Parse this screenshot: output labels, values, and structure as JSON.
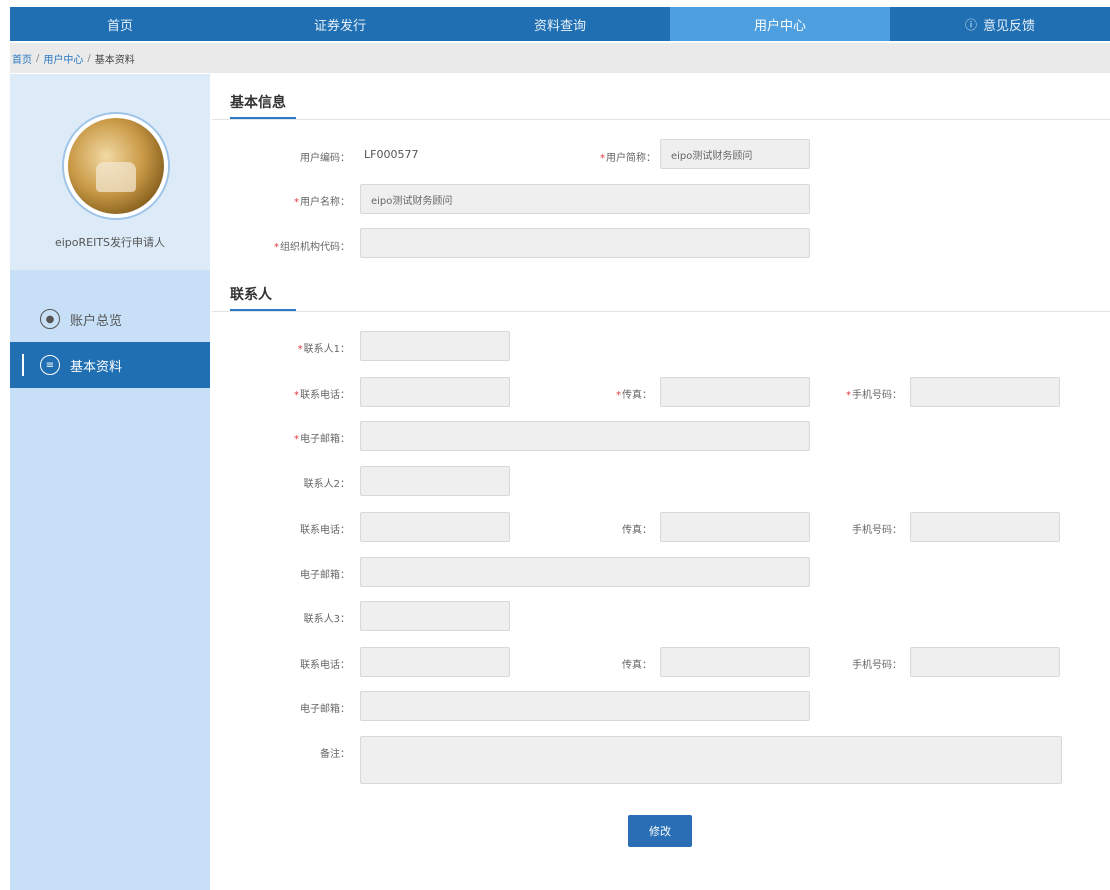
{
  "nav": {
    "items": [
      {
        "label": "首页"
      },
      {
        "label": "证券发行"
      },
      {
        "label": "资料查询"
      },
      {
        "label": "用户中心"
      },
      {
        "label": "意见反馈"
      }
    ]
  },
  "breadcrumb": {
    "home": "首页",
    "sep": "/",
    "user_center": "用户中心",
    "current": "基本资料"
  },
  "sidebar": {
    "profile_name": "eipoREITS发行申请人",
    "items": [
      {
        "label": "账户总览",
        "icon": "circle-dot-icon"
      },
      {
        "label": "基本资料",
        "icon": "list-circle-icon"
      }
    ]
  },
  "basic_info": {
    "title": "基本信息",
    "user_code_label": "用户编码：",
    "user_code_value": "LF000577",
    "nickname_label": "用户简称：",
    "nickname_value": "eipo测试财务顾问",
    "username_label": "用户名称：",
    "username_value": "eipo测试财务顾问",
    "org_code_label": "组织机构代码：",
    "org_code_value": ""
  },
  "contacts": {
    "title": "联系人",
    "c1": {
      "name_label": "联系人1：",
      "phone_label": "联系电话：",
      "fax_label": "传真：",
      "mobile_label": "手机号码：",
      "email_label": "电子邮箱："
    },
    "c2": {
      "name_label": "联系人2：",
      "phone_label": "联系电话：",
      "fax_label": "传真：",
      "mobile_label": "手机号码：",
      "email_label": "电子邮箱："
    },
    "c3": {
      "name_label": "联系人3：",
      "phone_label": "联系电话：",
      "fax_label": "传真：",
      "mobile_label": "手机号码：",
      "email_label": "电子邮箱："
    },
    "remark_label": "备注："
  },
  "actions": {
    "modify_label": "修改"
  },
  "colors": {
    "nav": "#1f6fb2",
    "nav_active": "#4d9fe0",
    "sidebar": "#c8e0f7",
    "required": "#e0393e",
    "button": "#2a6fb5"
  }
}
